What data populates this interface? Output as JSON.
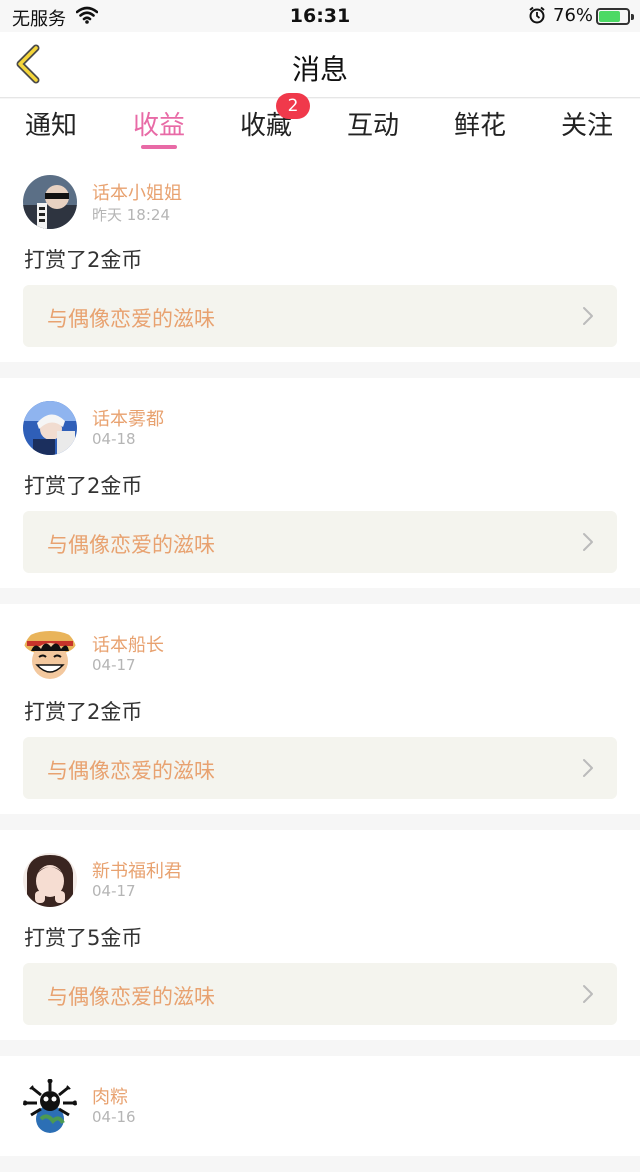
{
  "status_bar": {
    "carrier": "无服务",
    "time": "16:31",
    "battery_percent": "76%",
    "battery_level": 0.76,
    "icons": [
      "wifi-icon",
      "alarm-icon",
      "battery-charging-icon"
    ]
  },
  "nav": {
    "title": "消息",
    "back_icon": "chevron-left-icon",
    "accent_color": "#e86aa6"
  },
  "tabs": [
    {
      "label": "通知",
      "active": false
    },
    {
      "label": "收益",
      "active": true
    },
    {
      "label": "收藏",
      "active": false,
      "badge": "2"
    },
    {
      "label": "互动",
      "active": false
    },
    {
      "label": "鲜花",
      "active": false
    },
    {
      "label": "关注",
      "active": false
    }
  ],
  "items": [
    {
      "user": "话本小姐姐",
      "date": "昨天 18:24",
      "action": "打赏了2金币",
      "book": "与偶像恋爱的滋味"
    },
    {
      "user": "话本雾都",
      "date": "04-18",
      "action": "打赏了2金币",
      "book": "与偶像恋爱的滋味"
    },
    {
      "user": "话本船长",
      "date": "04-17",
      "action": "打赏了2金币",
      "book": "与偶像恋爱的滋味"
    },
    {
      "user": "新书福利君",
      "date": "04-17",
      "action": "打赏了5金币",
      "book": "与偶像恋爱的滋味"
    },
    {
      "user": "肉粽",
      "date": "04-16"
    }
  ]
}
